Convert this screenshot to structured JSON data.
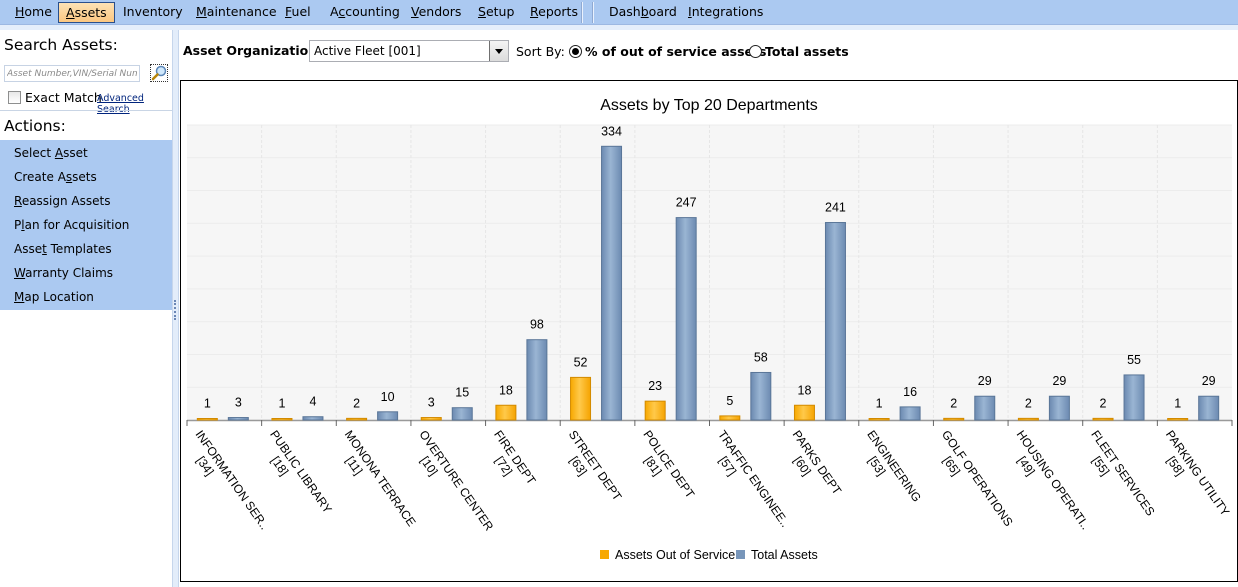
{
  "menu": {
    "items": [
      {
        "label": "Home",
        "accel": "H",
        "active": false
      },
      {
        "label": "Assets",
        "accel": "A",
        "active": true
      },
      {
        "label": "Inventory",
        "accel": "",
        "active": false
      },
      {
        "label": "Maintenance",
        "accel": "M",
        "active": false
      },
      {
        "label": "Fuel",
        "accel": "F",
        "active": false
      },
      {
        "label": "Accounting",
        "accel": "c",
        "active": false
      },
      {
        "label": "Vendors",
        "accel": "V",
        "active": false
      },
      {
        "label": "Setup",
        "accel": "S",
        "active": false
      },
      {
        "label": "Reports",
        "accel": "R",
        "active": false
      },
      {
        "label": "Dashboard",
        "accel": "b",
        "active": false
      },
      {
        "label": "Integrations",
        "accel": "I",
        "active": false
      }
    ]
  },
  "left_panel": {
    "search_title": "Search Assets:",
    "search_placeholder": "Asset Number,VIN/Serial Number",
    "search_icon": "magnifier-icon",
    "exact_match_label": "Exact Match",
    "exact_match_checked": false,
    "advanced_search_label": "Advanced Search",
    "actions_title": "Actions:",
    "actions": [
      {
        "label": "Select Asset",
        "accel": "A"
      },
      {
        "label": "Create Assets",
        "accel": "s"
      },
      {
        "label": "Reassign Assets",
        "accel": "R"
      },
      {
        "label": "Plan for Acquisition",
        "accel": "l"
      },
      {
        "label": "Asset Templates",
        "accel": "t"
      },
      {
        "label": "Warranty Claims",
        "accel": "W"
      },
      {
        "label": "Map Location",
        "accel": "M"
      }
    ]
  },
  "filters": {
    "org_label": "Asset Organization:",
    "org_value": "Active Fleet [001]",
    "sort_label": "Sort By:",
    "sort_options": [
      {
        "label": "% of out of service assets",
        "checked": true
      },
      {
        "label": "Total assets",
        "checked": false
      }
    ]
  },
  "chart_data": {
    "type": "bar",
    "title": "Assets by Top 20 Departments",
    "xlabel": "",
    "ylabel": "",
    "ylim": [
      0,
      360
    ],
    "grid": true,
    "legend_position": "bottom",
    "categories": [
      {
        "name": "INFORMATION SER..",
        "code": "[34]"
      },
      {
        "name": "PUBLIC LIBRARY",
        "code": "[18]"
      },
      {
        "name": "MONONA TERRACE",
        "code": "[11]"
      },
      {
        "name": "OVERTURE CENTER",
        "code": "[10]"
      },
      {
        "name": "FIRE DEPT",
        "code": "[72]"
      },
      {
        "name": "STREET DEPT",
        "code": "[63]"
      },
      {
        "name": "POLICE DEPT",
        "code": "[81]"
      },
      {
        "name": "TRAFFIC ENGINEE..",
        "code": "[57]"
      },
      {
        "name": "PARKS DEPT",
        "code": "[60]"
      },
      {
        "name": "ENGINEERING",
        "code": "[53]"
      },
      {
        "name": "GOLF OPERATIONS",
        "code": "[65]"
      },
      {
        "name": "HOUSING OPERATI..",
        "code": "[49]"
      },
      {
        "name": "FLEET SERVICES",
        "code": "[55]"
      },
      {
        "name": "PARKING UTILITY",
        "code": "[58]"
      }
    ],
    "series": [
      {
        "name": "Assets Out of Service",
        "color": "#f7a800",
        "values": [
          1,
          1,
          2,
          3,
          18,
          52,
          23,
          5,
          18,
          1,
          2,
          2,
          2,
          1
        ]
      },
      {
        "name": "Total Assets",
        "color": "#7896ba",
        "values": [
          3,
          4,
          10,
          15,
          98,
          334,
          247,
          58,
          241,
          16,
          29,
          29,
          55,
          29
        ]
      }
    ]
  }
}
